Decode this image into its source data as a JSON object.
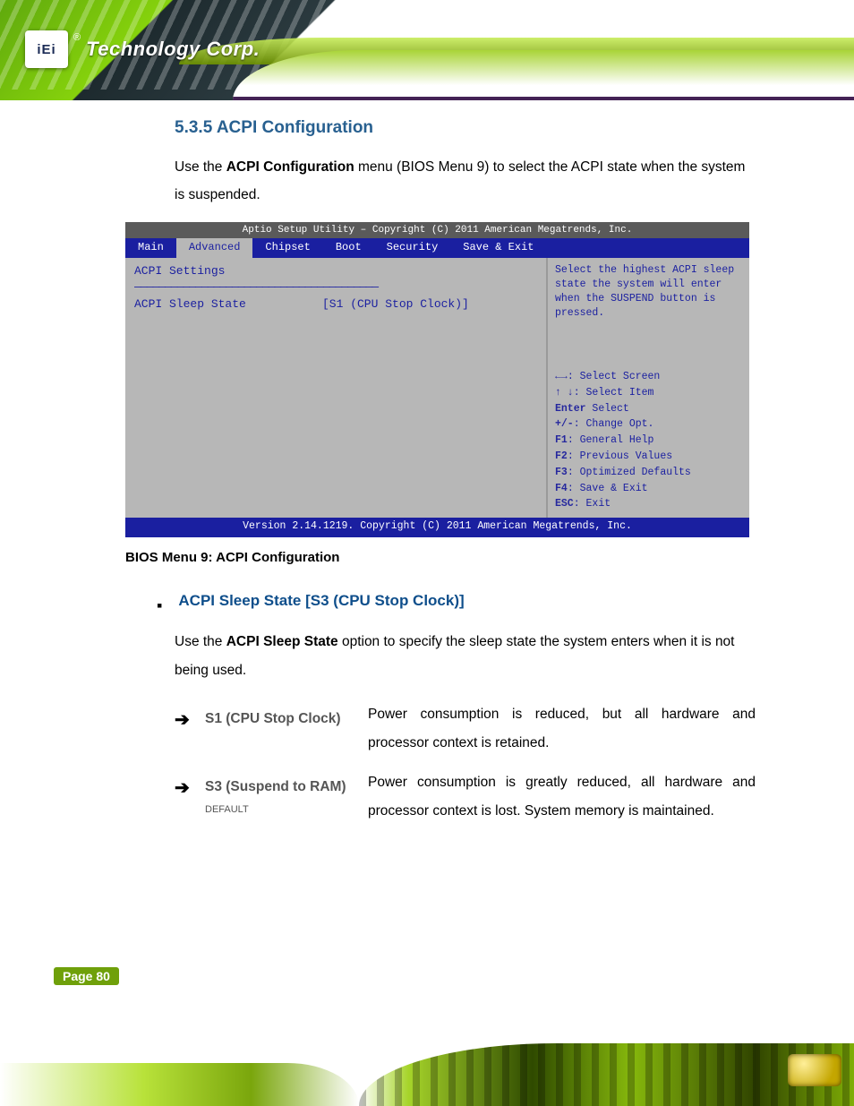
{
  "brand": {
    "logo_text": "iEi",
    "tagline": "Technology Corp.",
    "reg": "®"
  },
  "section_title": "5.3.5 ACPI Configuration",
  "intro": {
    "pre": "Use the ",
    "bold": "ACPI Configuration",
    "post": " menu (BIOS Menu 9) to select the ACPI state when the system is suspended."
  },
  "bios": {
    "util_title": "Aptio Setup Utility – Copyright (C) 2011 American Megatrends, Inc.",
    "tabs": [
      "Main",
      "Advanced",
      "Chipset",
      "Boot",
      "Security",
      "Save & Exit"
    ],
    "active_tab_index": 1,
    "panel_heading": "ACPI Settings",
    "setting_key": "ACPI Sleep State",
    "setting_value": "[S1 (CPU Stop Clock)]",
    "hint": "Select the highest ACPI sleep state the system will enter when the SUSPEND button is pressed.",
    "keys": [
      {
        "k": "←→",
        "d": ": Select Screen"
      },
      {
        "k": "↑ ↓",
        "d": ": Select Item"
      },
      {
        "k": "Enter",
        "d": "Select"
      },
      {
        "k": "+/-",
        "d": ": Change Opt."
      },
      {
        "k": "F1",
        "d": ": General Help"
      },
      {
        "k": "F2",
        "d": ": Previous Values"
      },
      {
        "k": "F3",
        "d": ": Optimized Defaults"
      },
      {
        "k": "F4",
        "d": ": Save & Exit"
      },
      {
        "k": "ESC",
        "d": ": Exit"
      }
    ],
    "footer": "Version 2.14.1219. Copyright (C) 2011 American Megatrends, Inc."
  },
  "bios_caption": "BIOS Menu 9: ACPI Configuration",
  "option": {
    "title": "ACPI Sleep State [S3 (CPU Stop Clock)]",
    "para_pre": "Use the ",
    "para_bold": "ACPI Sleep State",
    "para_post": " option to specify the sleep state the system enters when it is not being used.",
    "rows": [
      {
        "name": "S1 (CPU Stop Clock)",
        "default": "",
        "desc": "Power consumption is reduced, but all hardware and processor context is retained."
      },
      {
        "name": "S3 (Suspend to RAM)",
        "default": "DEFAULT",
        "desc": "Power consumption is greatly reduced, all hardware and processor context is lost. System memory is maintained."
      }
    ]
  },
  "page_number": "Page 80"
}
